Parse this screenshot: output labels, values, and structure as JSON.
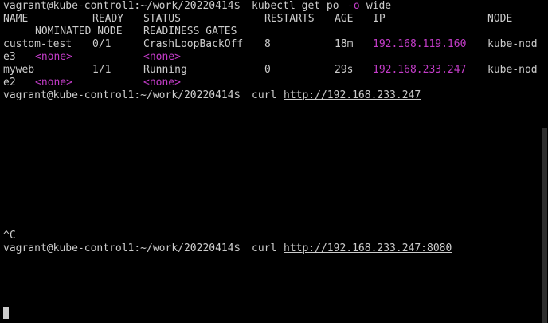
{
  "terminal": {
    "prompt": "vagrant@kube-control1:~/work/20220414$ ",
    "command1_pre": "kubectl get po ",
    "command1_flag": "-o",
    "command1_post": " wide",
    "header1": {
      "name": "NAME",
      "ready": "READY",
      "status": "STATUS",
      "restarts": "RESTARTS",
      "age": "AGE",
      "ip": "IP",
      "node": "NODE"
    },
    "header2": {
      "nominated": "NOMINATED NODE",
      "gates": "READINESS GATES"
    },
    "rows": [
      {
        "name": "custom-test",
        "ready": "0/1",
        "status": "CrashLoopBackOff",
        "restarts": "8",
        "age": "18m",
        "ip": "192.168.119.160",
        "node": "kube-nod",
        "node_wrap": "e3",
        "nominated": "<none>",
        "gates": "<none>"
      },
      {
        "name": "myweb",
        "ready": "1/1",
        "status": "Running",
        "restarts": "0",
        "age": "29s",
        "ip": "192.168.233.247",
        "node": "kube-nod",
        "node_wrap": "e2",
        "nominated": "<none>",
        "gates": "<none>"
      }
    ],
    "command2": "curl ",
    "command2_url": "http://192.168.233.247",
    "interrupt": "^C",
    "command3": "curl ",
    "command3_url": "http://192.168.233.247:8080"
  },
  "colors": {
    "background": "#000000",
    "text": "#cccccc",
    "ip_highlight": "#c33cc8"
  }
}
